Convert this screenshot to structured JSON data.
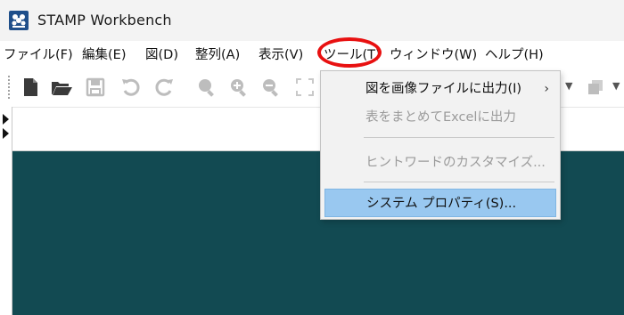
{
  "window": {
    "title": "STAMP Workbench",
    "icon": "stamp-app-icon"
  },
  "menubar": {
    "items": [
      {
        "label": "ファイル(F)"
      },
      {
        "label": "編集(E)"
      },
      {
        "label": "図(D)"
      },
      {
        "label": "整列(A)"
      },
      {
        "label": "表示(V)"
      },
      {
        "label": "ツール(T)",
        "highlighted": true
      },
      {
        "label": "ウィンドウ(W)"
      },
      {
        "label": "ヘルプ(H)"
      }
    ]
  },
  "toolbar": {
    "buttons": [
      {
        "icon": "new-file-icon",
        "enabled": true
      },
      {
        "icon": "open-folder-icon",
        "enabled": true
      },
      {
        "icon": "save-icon",
        "enabled": false
      },
      {
        "icon": "undo-icon",
        "enabled": false
      },
      {
        "icon": "redo-icon",
        "enabled": false
      },
      {
        "icon": "zoom-icon",
        "enabled": false
      },
      {
        "icon": "zoom-in-icon",
        "enabled": false
      },
      {
        "icon": "zoom-out-icon",
        "enabled": false
      },
      {
        "icon": "fit-screen-icon",
        "enabled": false
      }
    ]
  },
  "tools_menu": {
    "items": [
      {
        "label": "図を画像ファイルに出力(I)",
        "enabled": true,
        "submenu": true
      },
      {
        "label": "表をまとめてExcelに出力",
        "enabled": false
      },
      {
        "label": "ヒントワードのカスタマイズ...",
        "enabled": false
      },
      {
        "label": "システム プロパティ(S)...",
        "enabled": true,
        "selected": true
      }
    ],
    "submenu_arrow": "›"
  },
  "colors": {
    "annotation_circle": "#e81010",
    "canvas_background": "#124a52",
    "selected_item": "#99c8f0"
  }
}
